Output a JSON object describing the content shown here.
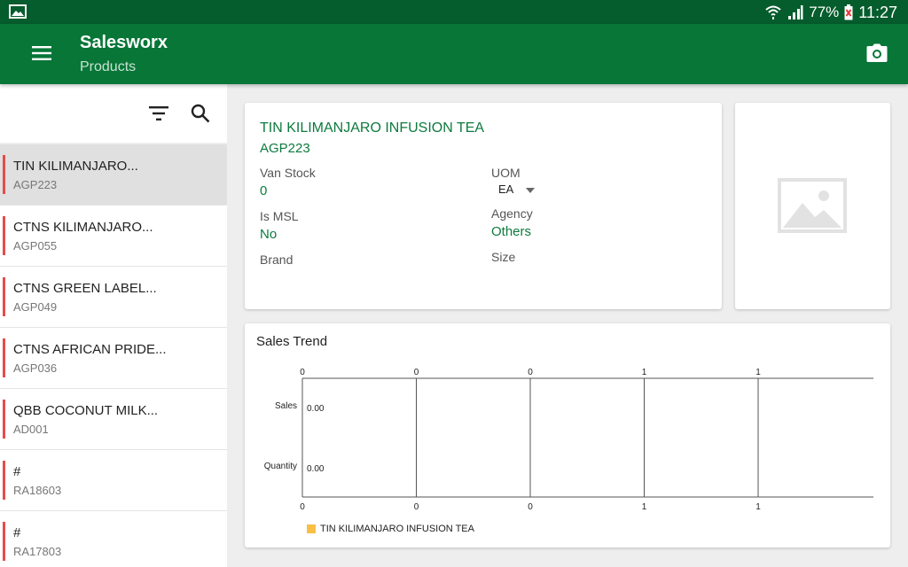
{
  "status_bar": {
    "battery_percent": "77%",
    "time": "11:27"
  },
  "app_bar": {
    "title": "Salesworx",
    "subtitle": "Products"
  },
  "sidebar": {
    "items": [
      {
        "name": "TIN KILIMANJARO...",
        "code": "AGP223",
        "selected": true
      },
      {
        "name": "CTNS KILIMANJARO...",
        "code": "AGP055",
        "selected": false
      },
      {
        "name": "CTNS GREEN LABEL...",
        "code": "AGP049",
        "selected": false
      },
      {
        "name": "CTNS AFRICAN PRIDE...",
        "code": "AGP036",
        "selected": false
      },
      {
        "name": "QBB COCONUT MILK...",
        "code": "AD001",
        "selected": false
      },
      {
        "name": "#",
        "code": "RA18603",
        "selected": false
      },
      {
        "name": "#",
        "code": "RA17803",
        "selected": false
      }
    ]
  },
  "product": {
    "title": "TIN KILIMANJARO INFUSION TEA",
    "code": "AGP223",
    "van_stock_label": "Van Stock",
    "van_stock_value": "0",
    "uom_label": "UOM",
    "uom_value": "EA",
    "is_msl_label": "Is MSL",
    "is_msl_value": "No",
    "agency_label": "Agency",
    "agency_value": "Others",
    "brand_label": "Brand",
    "size_label": "Size"
  },
  "sales_trend": {
    "title": "Sales Trend",
    "legend_color": "#f7c045"
  },
  "chart_data": {
    "type": "table",
    "top_ticks": [
      "0",
      "0",
      "0",
      "1",
      "1"
    ],
    "bottom_ticks": [
      "0",
      "0",
      "0",
      "1",
      "1"
    ],
    "rows": [
      {
        "label": "Sales",
        "value": "0.00"
      },
      {
        "label": "Quantity",
        "value": "0.00"
      }
    ],
    "legend": [
      "TIN KILIMANJARO INFUSION TEA"
    ]
  },
  "colors": {
    "status_bar": "#055c2c",
    "app_bar": "#077637",
    "accent_text": "#0d7a3e",
    "list_marker": "#e74c4c"
  }
}
